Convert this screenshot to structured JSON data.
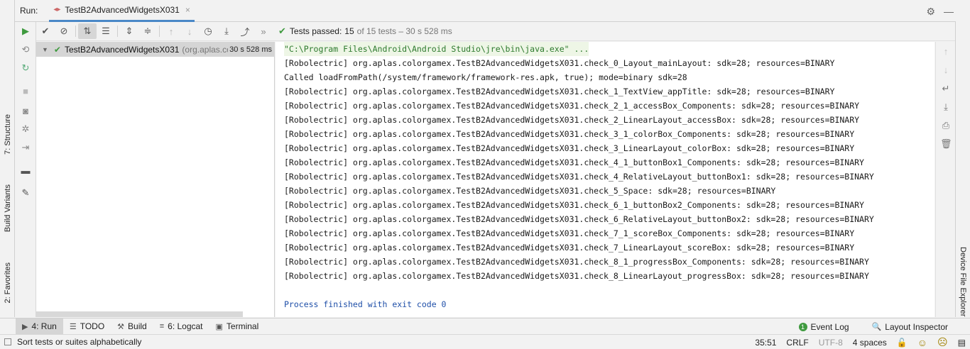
{
  "left_strip": {
    "tabs": [
      {
        "label": "7: Structure"
      },
      {
        "label": "Build Variants"
      },
      {
        "label": "2: Favorites"
      }
    ]
  },
  "right_strip": {
    "tab_label": "Device File Explorer"
  },
  "run_header": {
    "title": "Run:",
    "tab_label": "TestB2AdvancedWidgetsX031",
    "tab_close": "×"
  },
  "test_toolbar": {
    "status_label": "Tests passed:",
    "passed_count": "15",
    "detail": "of 15 tests – 30 s 528 ms"
  },
  "test_tree": {
    "root_name": "TestB2AdvancedWidgetsX031",
    "root_package": "(org.aplas.colorgamex)",
    "root_time": "30 s 528 ms"
  },
  "console": {
    "command": "\"C:\\Program Files\\Android\\Android Studio\\jre\\bin\\java.exe\" ...",
    "lines": [
      "[Robolectric] org.aplas.colorgamex.TestB2AdvancedWidgetsX031.check_0_Layout_mainLayout: sdk=28; resources=BINARY",
      "Called loadFromPath(/system/framework/framework-res.apk, true); mode=binary sdk=28",
      "[Robolectric] org.aplas.colorgamex.TestB2AdvancedWidgetsX031.check_1_TextView_appTitle: sdk=28; resources=BINARY",
      "[Robolectric] org.aplas.colorgamex.TestB2AdvancedWidgetsX031.check_2_1_accessBox_Components: sdk=28; resources=BINARY",
      "[Robolectric] org.aplas.colorgamex.TestB2AdvancedWidgetsX031.check_2_LinearLayout_accessBox: sdk=28; resources=BINARY",
      "[Robolectric] org.aplas.colorgamex.TestB2AdvancedWidgetsX031.check_3_1_colorBox_Components: sdk=28; resources=BINARY",
      "[Robolectric] org.aplas.colorgamex.TestB2AdvancedWidgetsX031.check_3_LinearLayout_colorBox: sdk=28; resources=BINARY",
      "[Robolectric] org.aplas.colorgamex.TestB2AdvancedWidgetsX031.check_4_1_buttonBox1_Components: sdk=28; resources=BINARY",
      "[Robolectric] org.aplas.colorgamex.TestB2AdvancedWidgetsX031.check_4_RelativeLayout_buttonBox1: sdk=28; resources=BINARY",
      "[Robolectric] org.aplas.colorgamex.TestB2AdvancedWidgetsX031.check_5_Space: sdk=28; resources=BINARY",
      "[Robolectric] org.aplas.colorgamex.TestB2AdvancedWidgetsX031.check_6_1_buttonBox2_Components: sdk=28; resources=BINARY",
      "[Robolectric] org.aplas.colorgamex.TestB2AdvancedWidgetsX031.check_6_RelativeLayout_buttonBox2: sdk=28; resources=BINARY",
      "[Robolectric] org.aplas.colorgamex.TestB2AdvancedWidgetsX031.check_7_1_scoreBox_Components: sdk=28; resources=BINARY",
      "[Robolectric] org.aplas.colorgamex.TestB2AdvancedWidgetsX031.check_7_LinearLayout_scoreBox: sdk=28; resources=BINARY",
      "[Robolectric] org.aplas.colorgamex.TestB2AdvancedWidgetsX031.check_8_1_progressBox_Components: sdk=28; resources=BINARY",
      "[Robolectric] org.aplas.colorgamex.TestB2AdvancedWidgetsX031.check_8_LinearLayout_progressBox: sdk=28; resources=BINARY"
    ],
    "exit_message": "Process finished with exit code 0"
  },
  "bottom_bar": {
    "tabs": [
      {
        "label": "4: Run",
        "icon": "play-icon"
      },
      {
        "label": "TODO",
        "icon": "list-icon"
      },
      {
        "label": "Build",
        "icon": "hammer-icon"
      },
      {
        "label": "6: Logcat",
        "icon": "logcat-icon"
      },
      {
        "label": "Terminal",
        "icon": "terminal-icon"
      }
    ],
    "event_log": "Event Log",
    "event_log_count": "1",
    "layout_inspector": "Layout Inspector"
  },
  "status_bar": {
    "message": "Sort tests or suites alphabetically",
    "position": "35:51",
    "line_sep": "CRLF",
    "encoding": "UTF-8",
    "indent": "4 spaces"
  },
  "colors": {
    "accent": "#4a88c7",
    "pass_green": "#3f9a3f",
    "exit_blue": "#1f4fa8"
  }
}
